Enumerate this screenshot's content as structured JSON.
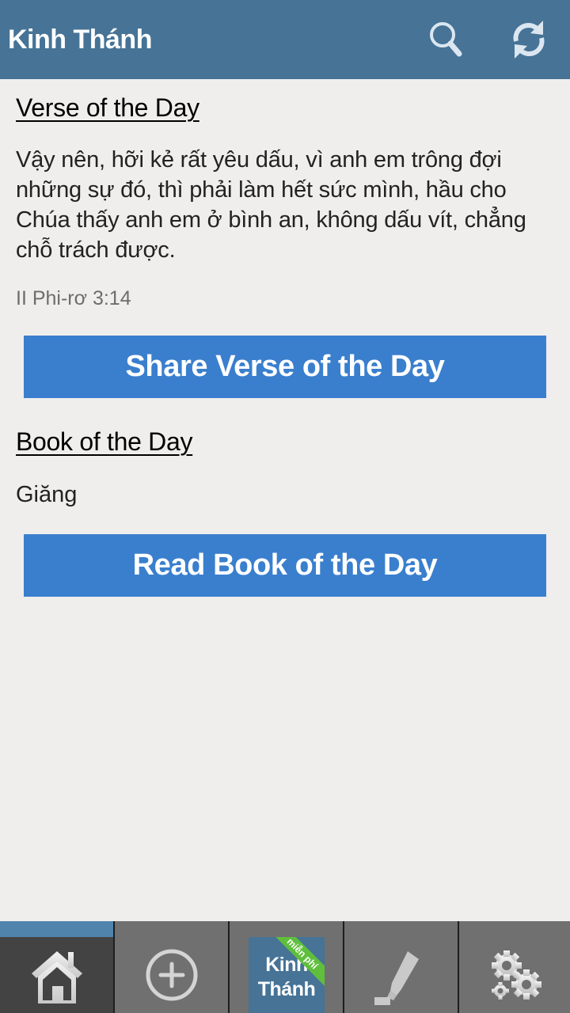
{
  "app": {
    "title": "Kinh Thánh",
    "actions": [
      {
        "name": "search",
        "icon": "search-icon"
      },
      {
        "name": "refresh",
        "icon": "refresh-icon"
      }
    ]
  },
  "verse_of_day": {
    "heading": "Verse of the Day",
    "text": "Vậy nên, hỡi kẻ rất yêu dấu, vì anh em trông đợi những sự đó, thì phải làm hết sức mình, hầu cho Chúa thấy anh em ở bình an, không dấu vít, chẳng chỗ trách được.",
    "reference": "II Phi-rơ 3:14",
    "share_button": "Share Verse of the Day"
  },
  "book_of_day": {
    "heading": "Book of the Day",
    "book": "Giăng",
    "read_button": "Read Book of the Day"
  },
  "bottom_nav": {
    "tabs": [
      {
        "name": "home",
        "icon": "home-icon",
        "active": true
      },
      {
        "name": "add",
        "icon": "add-circle-icon",
        "active": false
      },
      {
        "name": "bible",
        "icon": "app-logo",
        "logo_line1": "Kinh",
        "logo_line2": "Thánh",
        "ribbon": "miễn phí",
        "active": false
      },
      {
        "name": "highlight",
        "icon": "highlighter-icon",
        "active": false
      },
      {
        "name": "settings",
        "icon": "gears-icon",
        "active": false
      }
    ]
  },
  "colors": {
    "action_bar": "#467396",
    "button": "#3a7fce",
    "background": "#efeeed",
    "ribbon": "#5fbf3c"
  }
}
